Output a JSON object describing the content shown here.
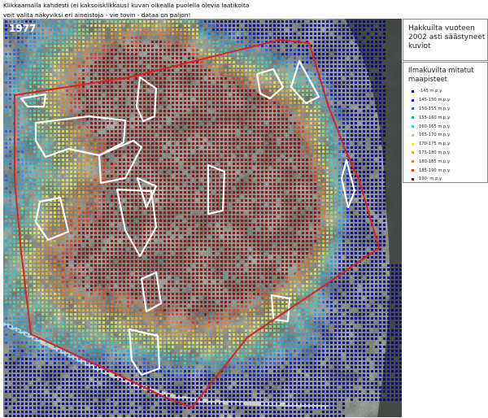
{
  "instructions": [
    "Klikkaamalla kahdesti (ei kaksoisklikkaus) kuvan oikealla puolella olevia laatikoita",
    "voit valita näkyviksi eri aineistoja - vie tovin - dataa on paljon!"
  ],
  "map": {
    "year_label": "1977"
  },
  "layers": {
    "cut_areas": {
      "label": "Hakkuilta vuoteen 2002 asti säästyneet kuviot"
    },
    "ground_points": {
      "label": "Ilmakuvilta mitatut maapisteet",
      "classes": [
        {
          "label": "-145 m.p.y.",
          "color": "#00008f"
        },
        {
          "label": "145-150 m.p.y.",
          "color": "#0019cf"
        },
        {
          "label": "150-155 m.p.y.",
          "color": "#1f60e6"
        },
        {
          "label": "155-160 m.p.y.",
          "color": "#19a6e6"
        },
        {
          "label": "160-165 m.p.y.",
          "color": "#34d0c8"
        },
        {
          "label": "165-170 m.p.y.",
          "color": "#8ae07a"
        },
        {
          "label": "170-175 m.p.y.",
          "color": "#e5e64c"
        },
        {
          "label": "175-180 m.p.y.",
          "color": "#e8b02a"
        },
        {
          "label": "180-185 m.p.y.",
          "color": "#e57c25"
        },
        {
          "label": "185-190 m.p.y.",
          "color": "#e23b1c"
        },
        {
          "label": "190- m.p.y.",
          "color": "#8a0a0a"
        }
      ]
    }
  },
  "boundary_color": "#e02020",
  "stand_outline_color": "#ffffff"
}
